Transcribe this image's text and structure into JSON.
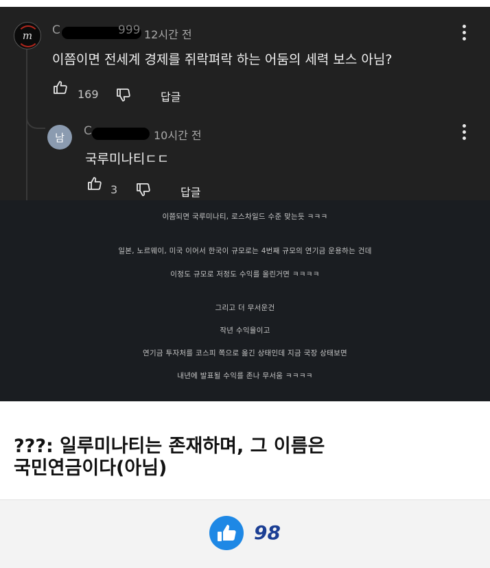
{
  "comment1": {
    "name_partial": "C",
    "name_tail": "999",
    "time": "12시간 전",
    "text": "이쯤이면 전세계 경제를 쥐락펴락 하는 어둠의 세력 보스 아님?",
    "likes": "169",
    "reply_label": "답글"
  },
  "comment2": {
    "avatar_letter": "남",
    "name_partial": "C",
    "time": "10시간 전",
    "text": "국루미나티ㄷㄷ",
    "likes": "3",
    "reply_label": "답글"
  },
  "caption_lines": [
    "이쯤되면 국루미나티, 로스차일드 수준 맞는듯 ㅋㅋㅋ",
    "일본, 노르웨이, 미국 이어서 한국이 규모로는 4번째 규모의 연기금 운용하는 건데",
    "이정도 규모로 저정도 수익를 올린거면 ㅋㅋㅋㅋ",
    "그리고 더 무서운건",
    "작년 수익율이고",
    "연기금 투자처를 코스피 쪽으로 옮긴 상태인데 지금 국장 상태보면",
    "내년에 발표될 수익를 존나 무서움 ㅋㅋㅋㅋ"
  ],
  "post": {
    "title_line1": "???: 일루미나티는 존재하며, 그 이름은",
    "title_line2": "국민연금이다(아님)"
  },
  "footer": {
    "like_count": "98"
  },
  "colors": {
    "accent": "#1e88e5",
    "count": "#1c3f94"
  },
  "icons": [
    "thumbs-up-icon",
    "thumbs-down-icon",
    "more-vert-icon"
  ]
}
